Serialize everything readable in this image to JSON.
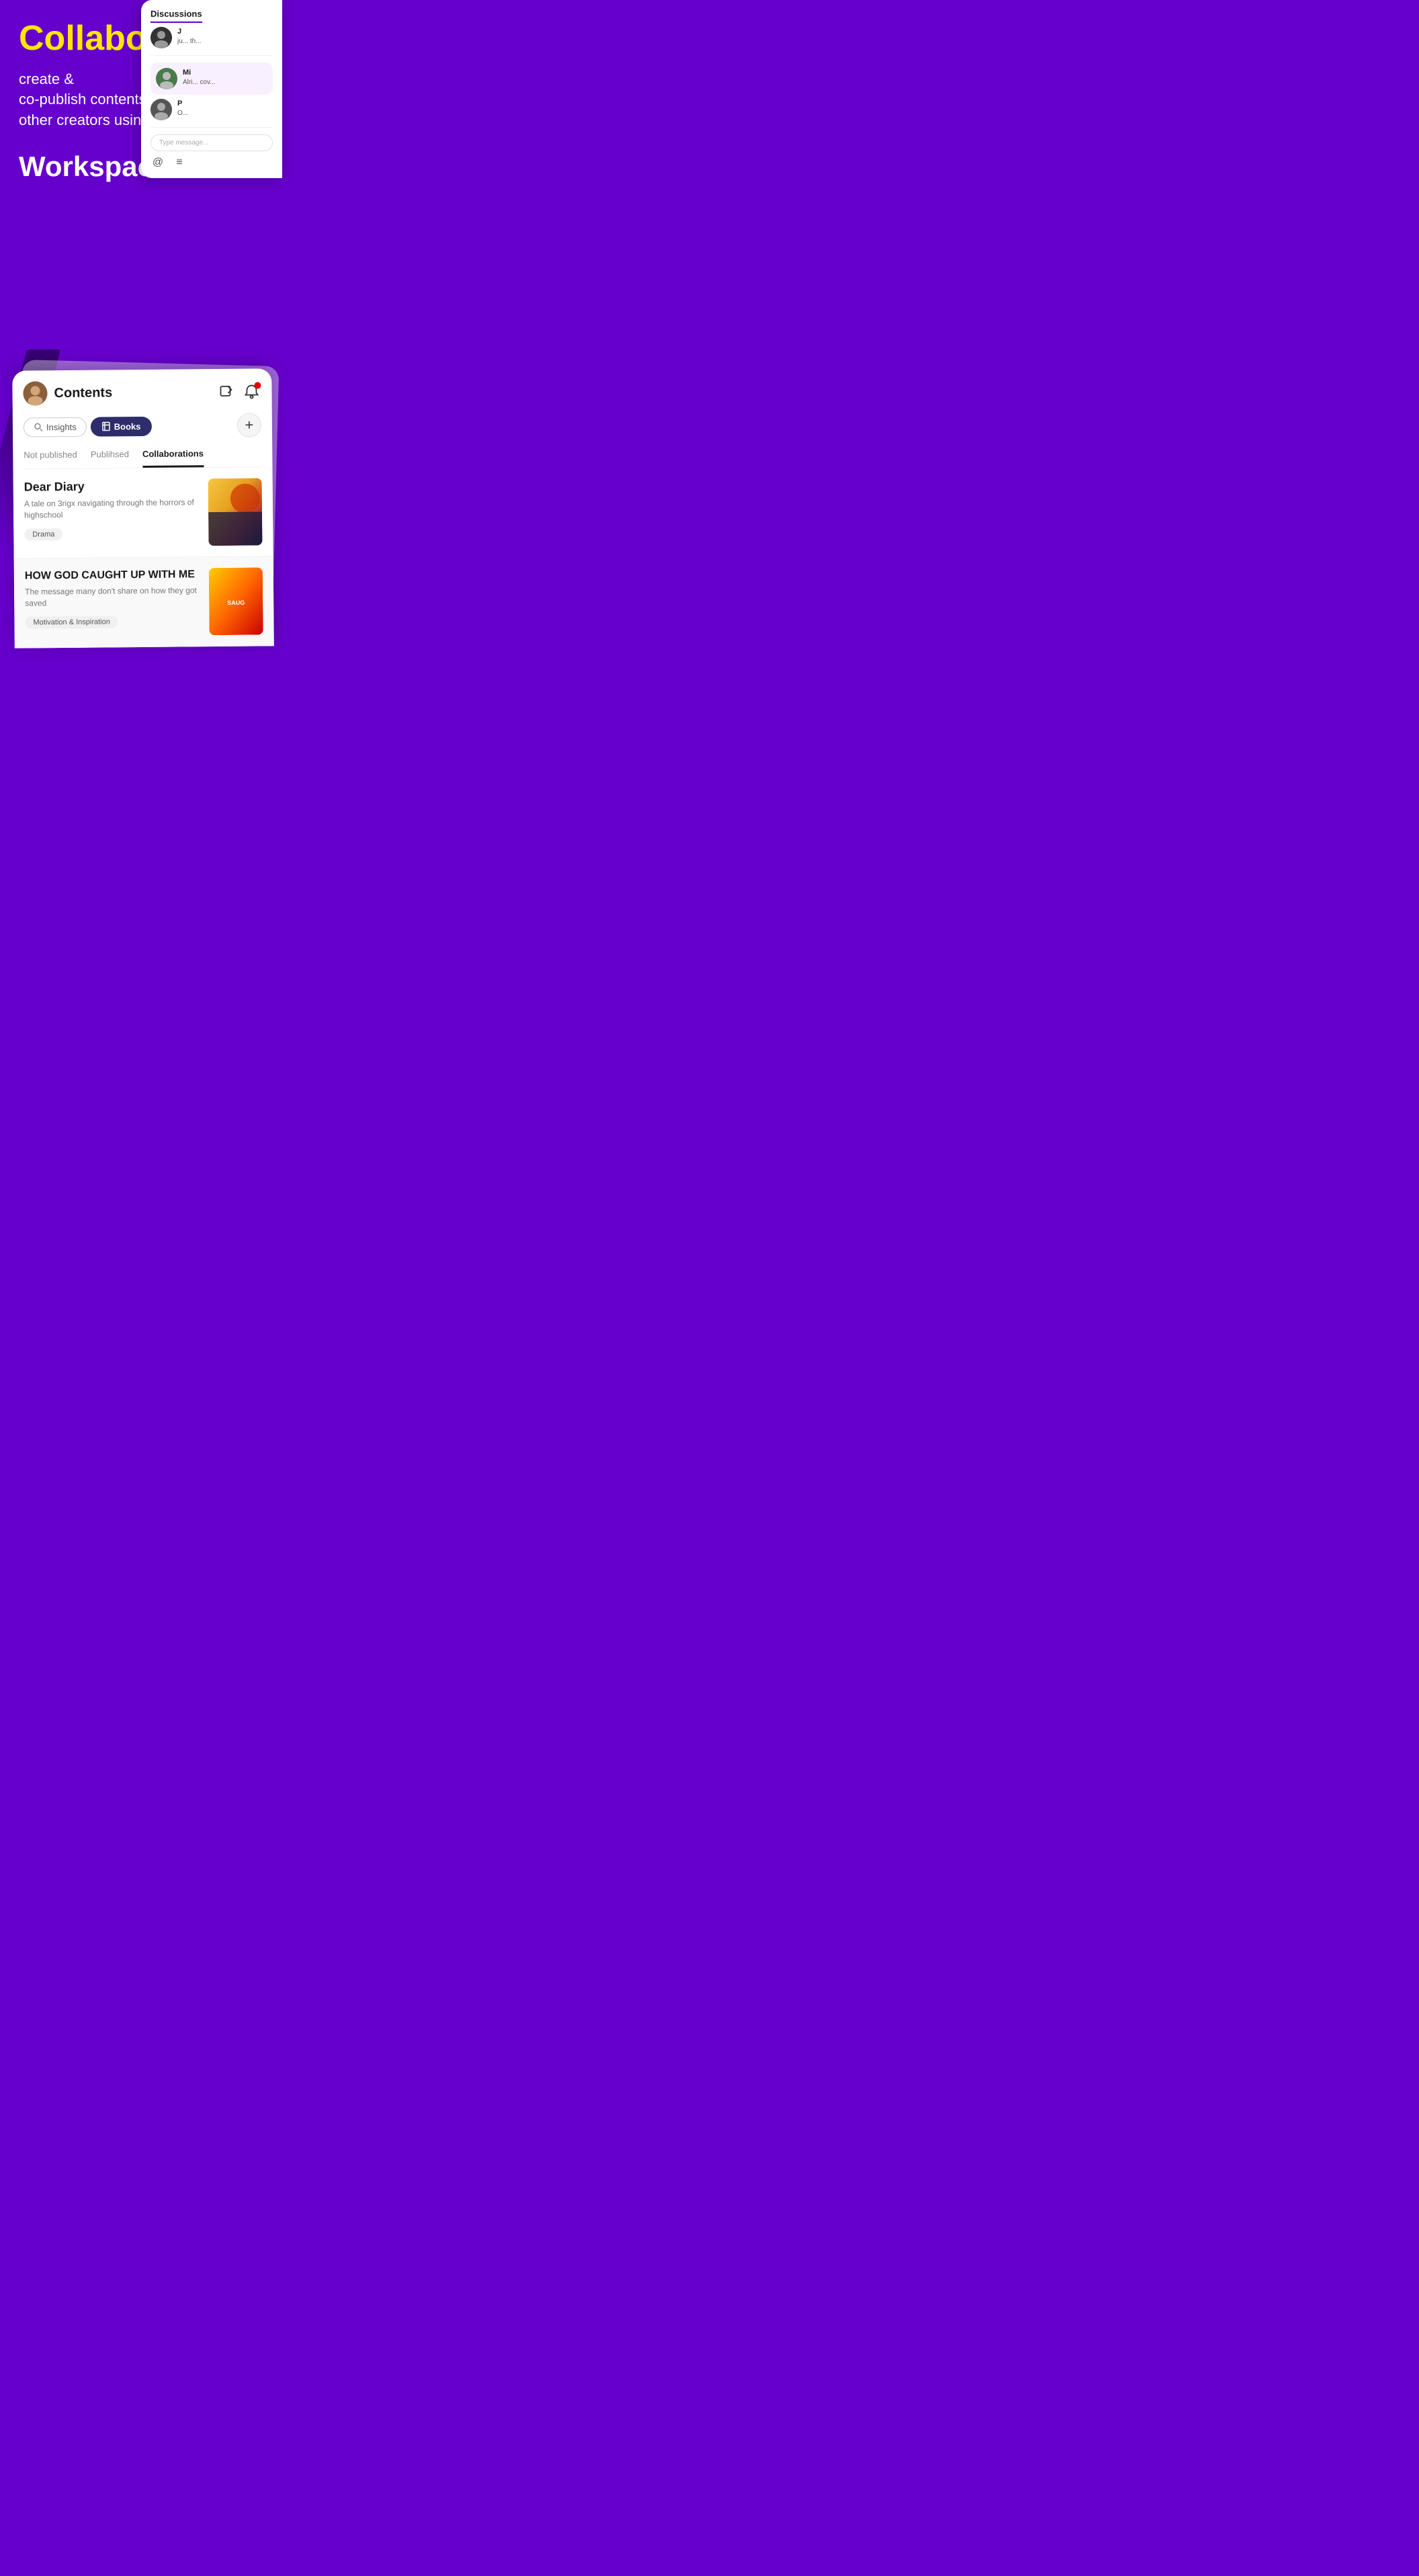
{
  "hero": {
    "collaborate_label": "Collaborate",
    "subtitle_line1": "create &",
    "subtitle_line2": "co-publish contents with",
    "subtitle_line3": "other creators using",
    "workspaces_label": "Workspaces"
  },
  "discussions": {
    "title": "Discussions",
    "items": [
      {
        "name": "J",
        "initials": "J",
        "snippet": "ju... th...",
        "avatar_color": "#333333"
      },
      {
        "name": "Mi",
        "initials": "M",
        "snippet": "Alri... cov...",
        "avatar_color": "#5a8a5a"
      },
      {
        "name": "P",
        "initials": "P",
        "snippet": "O...",
        "avatar_color": "#444444"
      }
    ],
    "message_placeholder": "Type message...",
    "toolbar_at": "@",
    "toolbar_list": "≡"
  },
  "contents": {
    "title": "Contents",
    "tabs": {
      "insights": "Insights",
      "books": "Books",
      "add": "+"
    },
    "sub_tabs": [
      {
        "label": "Not published",
        "active": false
      },
      {
        "label": "Publihsed",
        "active": false
      },
      {
        "label": "Collaborations",
        "active": true
      }
    ],
    "books": [
      {
        "title": "Dear Diary",
        "description": "A tale on 3rigx navigating through the horrors of highschool",
        "tag": "Drama"
      },
      {
        "title": "HOW GOD CAUGHT UP WITH ME",
        "description": "The message many don't share on how they got saved",
        "tag": "Motivation & Inspiration"
      }
    ]
  }
}
